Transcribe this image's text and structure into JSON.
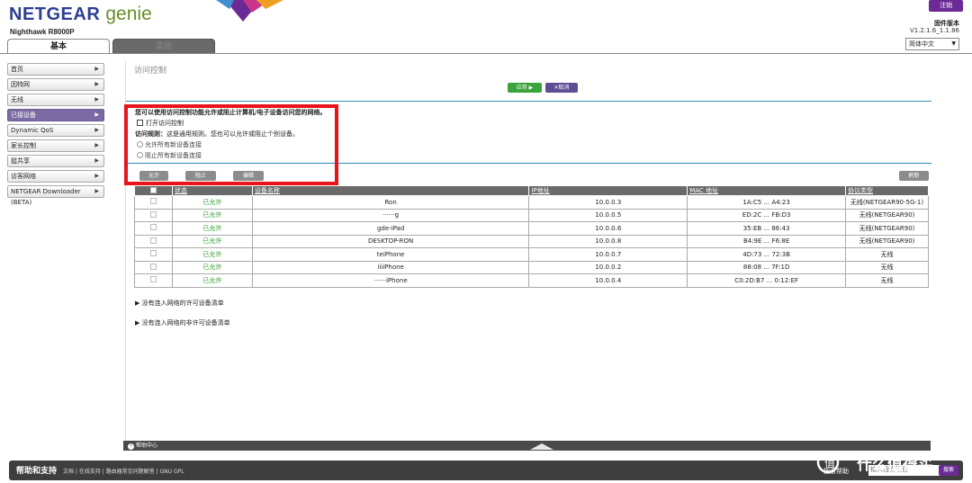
{
  "header": {
    "brand": "NETGEAR",
    "brand_genie": "genie",
    "model": "Nighthawk R8000P",
    "logout": "注销",
    "firmware_label": "固件版本",
    "firmware_version": "V1.2.1.6_1.1.86",
    "language": "简体中文",
    "tabs": {
      "basic": "基本",
      "advanced": "高级"
    }
  },
  "sidebar": {
    "items": [
      {
        "label": "首页"
      },
      {
        "label": "因特网"
      },
      {
        "label": "无线"
      },
      {
        "label": "已接设备"
      },
      {
        "label": "Dynamic QoS"
      },
      {
        "label": "家长控制"
      },
      {
        "label": "挺共享"
      },
      {
        "label": "访客网络"
      },
      {
        "label": "NETGEAR Downloader (BETA)"
      }
    ]
  },
  "main": {
    "title": "访问控制",
    "apply": "应用 ▶",
    "cancel": "✕取消",
    "description": "您可以使用访问控制功能允许或阻止计算机/电子设备访问您的网络。",
    "enable_label": "打开访问控制",
    "rule_label": "访问规则：",
    "rule_text": "这是通用规则。您也可以允许或阻止个别设备。",
    "radio_allow": "允许所有新设备连接",
    "radio_block": "阻止所有新设备连接",
    "btn_allow": "允许",
    "btn_block": "阻止",
    "btn_edit": "编辑",
    "btn_refresh": "刷新",
    "table": {
      "headers": [
        "状态",
        "设备名称",
        "IP地址",
        "MAC 地址",
        "协议类型"
      ],
      "rows": [
        {
          "status": "已允许",
          "name": "Ron",
          "ip": "10.0.0.3",
          "mac": "1A:C5 ... A4:23",
          "type": "无线(NETGEAR90-5G-1)"
        },
        {
          "status": "已允许",
          "name": "······g",
          "ip": "10.0.0.5",
          "mac": "ED:2C ... FB:D3",
          "type": "无线(NETGEAR90)"
        },
        {
          "status": "已允许",
          "name": "gde-iPad",
          "ip": "10.0.0.6",
          "mac": "35:EB ... 86:43",
          "type": "无线(NETGEAR90)"
        },
        {
          "status": "已允许",
          "name": "DESKTOP-RON",
          "ip": "10.0.0.8",
          "mac": "B4:9E ... F6:8E",
          "type": "无线(NETGEAR90)"
        },
        {
          "status": "已允许",
          "name": "teiPhone",
          "ip": "10.0.0.7",
          "mac": "4D:73 ... 72:3B",
          "type": "无线"
        },
        {
          "status": "已允许",
          "name": "iiiiPhone",
          "ip": "10.0.0.2",
          "mac": "88:08 ... 7F:1D",
          "type": "无线"
        },
        {
          "status": "已允许",
          "name": "······iPhone",
          "ip": "10.0.0.4",
          "mac": "C0:2D:B7 ... 0:12:EF",
          "type": "无线"
        }
      ]
    },
    "allowed_list": "没有连入网络的许可设备清单",
    "blocked_list": "没有连入网络的非许可设备清单"
  },
  "helpbar": {
    "label": "帮助中心"
  },
  "footer": {
    "title": "帮助和支持",
    "links": "文档 | 在线支持 | 路由器常见问题解答 | GNU GPL",
    "search_label": "搜索帮助",
    "search_placeholder": "输入搜索项目",
    "search_button": "搜索"
  },
  "watermark": "什么值得买",
  "colors": {
    "accent": "#6b2a95",
    "apply": "#3aa33a",
    "highlight": "#e8141a",
    "teal": "#2e8bb5",
    "allowed": "#2b9a2b"
  }
}
